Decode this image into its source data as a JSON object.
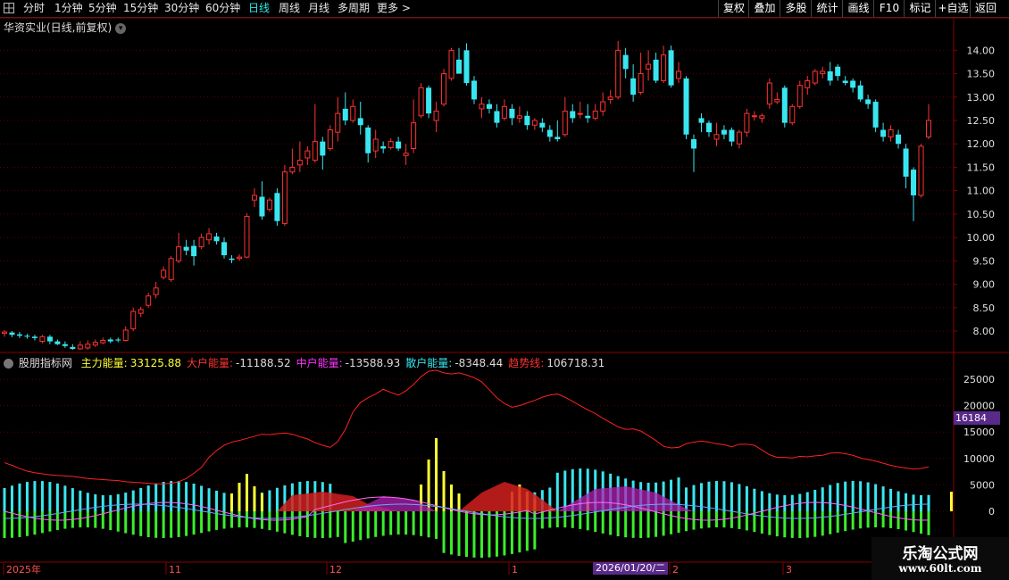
{
  "toolbar": {
    "periods": [
      "分时",
      "1分钟",
      "5分钟",
      "15分钟",
      "30分钟",
      "60分钟",
      "日线",
      "周线",
      "月线",
      "多周期",
      "更多 >"
    ],
    "active_period": "日线",
    "right_buttons": [
      "复权",
      "叠加",
      "多股",
      "统计",
      "画线",
      "F10",
      "标记",
      "+自选",
      "返回"
    ]
  },
  "stock": {
    "title": "华资实业(日线,前复权)"
  },
  "colors": {
    "up": "#ff3232",
    "down": "#39e6f0",
    "grid": "#5a0000",
    "axis_text": "#e0e0e0",
    "bg": "#000000"
  },
  "price_axis": {
    "ticks": [
      "14.00",
      "13.50",
      "13.00",
      "12.50",
      "12.00",
      "11.50",
      "11.00",
      "10.50",
      "10.00",
      "9.50",
      "9.00",
      "8.50",
      "8.00"
    ]
  },
  "indicator": {
    "name": "股朋指标网",
    "legend": [
      {
        "label": "主力能量:",
        "value": "33125.88",
        "color": "#ffff33"
      },
      {
        "label": "大户能量:",
        "value": "-11188.52",
        "color": "#ff3232"
      },
      {
        "label": "中户能量:",
        "value": "-13588.93",
        "color": "#ff33ff"
      },
      {
        "label": "散户能量:",
        "value": "-8348.44",
        "color": "#39e6f0"
      },
      {
        "label": "趋势线:",
        "value": "106718.31",
        "color": "#ff3232"
      }
    ],
    "axis_ticks": [
      "25000",
      "20000",
      "15000",
      "10000",
      "5000",
      "0"
    ],
    "cursor_value": "16184"
  },
  "time_axis": {
    "labels": [
      "2025年",
      "11",
      "12",
      "1",
      "2",
      "3"
    ],
    "date_badge": "2026/01/20/二"
  },
  "watermark": {
    "line1": "乐淘公式网",
    "line2": "www.60lt.com"
  },
  "chart_data": {
    "type": "candlestick",
    "ylim": [
      7.6,
      14.35
    ],
    "candles": [
      [
        7.95,
        7.98,
        7.88,
        8.02
      ],
      [
        7.97,
        7.92,
        7.87,
        8.0
      ],
      [
        7.93,
        7.9,
        7.85,
        7.98
      ],
      [
        7.9,
        7.88,
        7.84,
        7.94
      ],
      [
        7.88,
        7.85,
        7.8,
        7.92
      ],
      [
        7.78,
        7.88,
        7.74,
        7.92
      ],
      [
        7.88,
        7.78,
        7.72,
        7.92
      ],
      [
        7.78,
        7.72,
        7.7,
        7.82
      ],
      [
        7.72,
        7.68,
        7.64,
        7.78
      ],
      [
        7.66,
        7.62,
        7.6,
        7.72
      ],
      [
        7.62,
        7.7,
        7.6,
        7.78
      ],
      [
        7.64,
        7.72,
        7.6,
        7.8
      ],
      [
        7.7,
        7.76,
        7.66,
        7.82
      ],
      [
        7.75,
        7.8,
        7.72,
        7.86
      ],
      [
        7.82,
        7.78,
        7.74,
        7.86
      ],
      [
        7.82,
        7.8,
        7.76,
        7.86
      ],
      [
        7.8,
        8.02,
        7.78,
        8.1
      ],
      [
        8.05,
        8.42,
        8.0,
        8.5
      ],
      [
        8.38,
        8.46,
        8.3,
        8.52
      ],
      [
        8.55,
        8.75,
        8.5,
        8.82
      ],
      [
        8.78,
        8.92,
        8.7,
        9.05
      ],
      [
        9.15,
        9.3,
        9.1,
        9.38
      ],
      [
        9.1,
        9.55,
        9.05,
        9.6
      ],
      [
        9.5,
        9.8,
        9.45,
        10.1
      ],
      [
        9.8,
        9.72,
        9.62,
        9.95
      ],
      [
        9.82,
        9.6,
        9.4,
        9.95
      ],
      [
        9.8,
        10.0,
        9.75,
        10.08
      ],
      [
        9.95,
        10.08,
        9.85,
        10.2
      ],
      [
        10.02,
        9.92,
        9.85,
        10.1
      ],
      [
        9.9,
        9.62,
        9.55,
        10.0
      ],
      [
        9.55,
        9.52,
        9.45,
        9.62
      ],
      [
        9.55,
        9.58,
        9.5,
        9.64
      ],
      [
        9.58,
        10.45,
        9.56,
        10.52
      ],
      [
        10.8,
        10.9,
        10.65,
        11.05
      ],
      [
        10.87,
        10.45,
        10.38,
        11.2
      ],
      [
        10.6,
        10.8,
        10.55,
        10.85
      ],
      [
        10.95,
        10.35,
        10.25,
        11.05
      ],
      [
        10.3,
        11.4,
        10.25,
        11.55
      ],
      [
        11.4,
        11.5,
        11.35,
        11.9
      ],
      [
        11.55,
        11.65,
        11.4,
        12.05
      ],
      [
        11.7,
        11.85,
        11.55,
        11.95
      ],
      [
        11.65,
        12.05,
        11.6,
        12.85
      ],
      [
        12.05,
        11.75,
        11.45,
        12.15
      ],
      [
        11.9,
        12.3,
        11.85,
        12.4
      ],
      [
        12.25,
        12.65,
        12.05,
        13.0
      ],
      [
        12.75,
        12.5,
        12.4,
        13.1
      ],
      [
        12.5,
        12.8,
        12.45,
        12.95
      ],
      [
        12.55,
        12.4,
        12.2,
        12.9
      ],
      [
        12.35,
        11.8,
        11.6,
        12.4
      ],
      [
        11.85,
        12.1,
        11.7,
        12.3
      ],
      [
        11.95,
        11.9,
        11.8,
        12.05
      ],
      [
        11.92,
        12.05,
        11.88,
        12.12
      ],
      [
        12.05,
        11.9,
        11.85,
        12.15
      ],
      [
        11.75,
        11.8,
        11.55,
        12.0
      ],
      [
        11.9,
        12.45,
        11.8,
        12.95
      ],
      [
        12.6,
        13.2,
        12.55,
        13.3
      ],
      [
        13.2,
        12.65,
        12.55,
        13.25
      ],
      [
        12.5,
        12.7,
        12.25,
        12.9
      ],
      [
        12.85,
        13.5,
        12.8,
        13.6
      ],
      [
        13.4,
        14.0,
        13.35,
        14.05
      ],
      [
        13.8,
        13.5,
        13.5,
        14.05
      ],
      [
        14.0,
        13.3,
        13.25,
        14.15
      ],
      [
        13.35,
        12.95,
        12.85,
        13.45
      ],
      [
        12.75,
        12.85,
        12.55,
        13.0
      ],
      [
        12.85,
        12.75,
        12.65,
        12.95
      ],
      [
        12.7,
        12.45,
        12.35,
        12.85
      ],
      [
        12.55,
        12.8,
        12.5,
        12.95
      ],
      [
        12.75,
        12.55,
        12.4,
        12.85
      ],
      [
        12.55,
        12.6,
        12.45,
        12.8
      ],
      [
        12.6,
        12.4,
        12.3,
        12.7
      ],
      [
        12.4,
        12.5,
        12.3,
        12.55
      ],
      [
        12.45,
        12.35,
        12.25,
        12.55
      ],
      [
        12.3,
        12.15,
        12.05,
        12.4
      ],
      [
        12.15,
        12.1,
        12.05,
        12.5
      ],
      [
        12.2,
        12.7,
        12.15,
        13.0
      ],
      [
        12.7,
        12.55,
        12.45,
        12.85
      ],
      [
        12.65,
        12.65,
        12.55,
        12.9
      ],
      [
        12.6,
        12.55,
        12.45,
        12.85
      ],
      [
        12.55,
        12.7,
        12.5,
        12.85
      ],
      [
        12.7,
        12.9,
        12.6,
        13.1
      ],
      [
        12.95,
        13.0,
        12.85,
        13.15
      ],
      [
        13.0,
        14.0,
        12.95,
        14.2
      ],
      [
        13.9,
        13.6,
        13.4,
        14.05
      ],
      [
        13.4,
        13.05,
        12.9,
        13.7
      ],
      [
        13.1,
        13.5,
        13.05,
        13.95
      ],
      [
        13.6,
        13.7,
        13.35,
        14.0
      ],
      [
        13.8,
        13.35,
        13.3,
        13.95
      ],
      [
        13.35,
        13.9,
        13.3,
        14.1
      ],
      [
        14.0,
        13.25,
        13.2,
        14.1
      ],
      [
        13.4,
        13.55,
        13.3,
        13.75
      ],
      [
        13.4,
        12.2,
        12.1,
        13.45
      ],
      [
        12.1,
        11.9,
        11.4,
        12.2
      ],
      [
        12.55,
        12.45,
        12.25,
        12.65
      ],
      [
        12.45,
        12.25,
        12.15,
        12.5
      ],
      [
        12.1,
        12.2,
        11.95,
        12.45
      ],
      [
        12.3,
        12.2,
        12.1,
        12.4
      ],
      [
        12.3,
        12.05,
        11.95,
        12.35
      ],
      [
        12.0,
        12.25,
        11.9,
        12.3
      ],
      [
        12.25,
        12.65,
        12.15,
        12.75
      ],
      [
        12.6,
        12.6,
        12.5,
        12.7
      ],
      [
        12.55,
        12.6,
        12.45,
        12.65
      ],
      [
        12.85,
        13.3,
        12.75,
        13.4
      ],
      [
        12.9,
        12.95,
        12.85,
        13.1
      ],
      [
        13.2,
        12.45,
        12.35,
        13.25
      ],
      [
        12.45,
        12.8,
        12.4,
        12.85
      ],
      [
        12.8,
        13.25,
        12.75,
        13.35
      ],
      [
        13.2,
        13.35,
        13.05,
        13.45
      ],
      [
        13.3,
        13.55,
        13.25,
        13.6
      ],
      [
        13.5,
        13.55,
        13.4,
        13.65
      ],
      [
        13.55,
        13.35,
        13.25,
        13.75
      ],
      [
        13.65,
        13.45,
        13.35,
        13.7
      ],
      [
        13.35,
        13.3,
        13.25,
        13.45
      ],
      [
        13.35,
        13.2,
        13.1,
        13.4
      ],
      [
        13.25,
        12.95,
        12.9,
        13.35
      ],
      [
        12.95,
        12.85,
        12.75,
        13.05
      ],
      [
        12.9,
        12.35,
        12.25,
        12.95
      ],
      [
        12.3,
        12.15,
        12.05,
        12.45
      ],
      [
        12.15,
        12.3,
        12.05,
        12.4
      ],
      [
        12.2,
        12.0,
        11.9,
        12.3
      ],
      [
        11.9,
        11.3,
        11.05,
        12.0
      ],
      [
        11.45,
        10.9,
        10.35,
        11.5
      ],
      [
        10.9,
        11.95,
        10.85,
        12.0
      ],
      [
        12.15,
        12.5,
        12.1,
        12.85
      ]
    ]
  }
}
